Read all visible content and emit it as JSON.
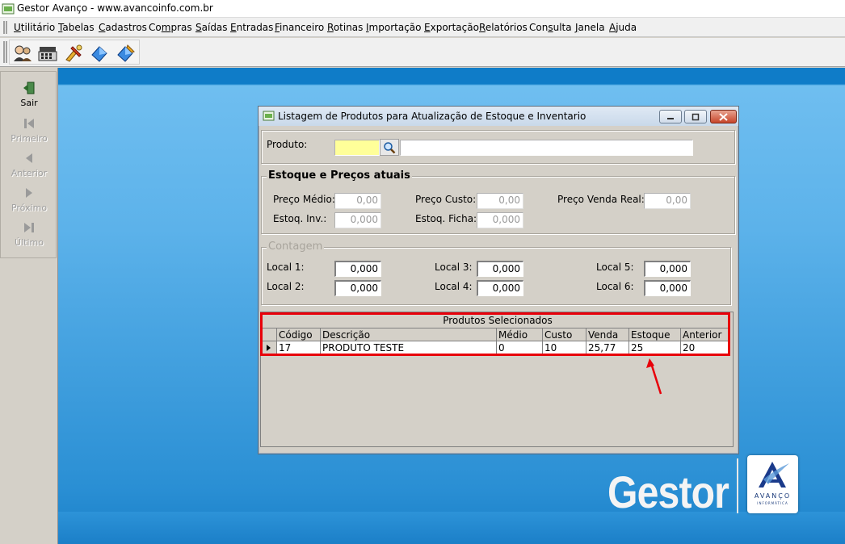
{
  "app": {
    "title": "Gestor Avanço - www.avancoinfo.com.br"
  },
  "menu": [
    {
      "label": "Utilitário",
      "accel": "U",
      "rest": "tilitário"
    },
    {
      "label": "Tabelas",
      "accel": "T",
      "rest": "abelas"
    },
    {
      "label": "Cadastros",
      "accel": "C",
      "rest": "adastros"
    },
    {
      "label": "Compras",
      "accel": "",
      "pre": "Co",
      "mid": "m",
      "rest": "pras"
    },
    {
      "label": "Saídas",
      "accel": "S",
      "rest": "aídas"
    },
    {
      "label": "Entradas",
      "accel": "E",
      "rest": "ntradas"
    },
    {
      "label": "Financeiro",
      "accel": "F",
      "rest": "inanceiro"
    },
    {
      "label": "Rotinas",
      "accel": "R",
      "rest": "otinas"
    },
    {
      "label": "Importação",
      "accel": "I",
      "rest": "mportação"
    },
    {
      "label": "Exportação",
      "accel": "E",
      "rest": "xportação"
    },
    {
      "label": "Relatórios",
      "accel": "R",
      "rest": "elatórios"
    },
    {
      "label": "Consulta",
      "accel": "",
      "pre": "Con",
      "mid": "s",
      "rest": "ulta"
    },
    {
      "label": "Janela",
      "accel": "J",
      "rest": "anela"
    },
    {
      "label": "Ajuda",
      "accel": "A",
      "rest": "juda"
    }
  ],
  "toolbar_icons": [
    "users-icon",
    "cash-register-icon",
    "tools-icon",
    "blue-box-icon",
    "blue-pen-box-icon"
  ],
  "sidebar": {
    "items": [
      {
        "label": "Sair",
        "icon": "exit-door-icon",
        "enabled": true
      },
      {
        "label": "Primeiro",
        "icon": "first-record-icon",
        "enabled": false
      },
      {
        "label": "Anterior",
        "icon": "previous-record-icon",
        "enabled": false
      },
      {
        "label": "Próximo",
        "icon": "next-record-icon",
        "enabled": false
      },
      {
        "label": "Último",
        "icon": "last-record-icon",
        "enabled": false
      }
    ]
  },
  "dialog": {
    "title": "Listagem de Produtos para Atualização de Estoque e Inventario",
    "produto": {
      "label": "Produto:",
      "code_value": "",
      "description_value": ""
    },
    "estoque_group": {
      "title": "Estoque e Preços atuais",
      "preco_medio": {
        "label": "Preço Médio:",
        "value": "0,00"
      },
      "preco_custo": {
        "label": "Preço Custo:",
        "value": "0,00"
      },
      "preco_venda_real": {
        "label": "Preço Venda Real:",
        "value": "0,00"
      },
      "estoq_inv": {
        "label": "Estoq. Inv.:",
        "value": "0,000"
      },
      "estoq_ficha": {
        "label": "Estoq. Ficha:",
        "value": "0,000"
      }
    },
    "contagem_group": {
      "title": "Contagem",
      "local1": {
        "label": "Local 1:",
        "value": "0,000"
      },
      "local2": {
        "label": "Local 2:",
        "value": "0,000"
      },
      "local3": {
        "label": "Local 3:",
        "value": "0,000"
      },
      "local4": {
        "label": "Local 4:",
        "value": "0,000"
      },
      "local5": {
        "label": "Local 5:",
        "value": "0,000"
      },
      "local6": {
        "label": "Local 6:",
        "value": "0,000"
      }
    },
    "grid": {
      "caption": "Produtos Selecionados",
      "columns": [
        "Código",
        "Descrição",
        "Médio",
        "Custo",
        "Venda",
        "Estoque",
        "Anterior"
      ],
      "rows": [
        [
          "17",
          "PRODUTO TESTE",
          "0",
          "10",
          "25,77",
          "25",
          "20"
        ]
      ]
    }
  },
  "branding": {
    "product": "Gestor",
    "logo_word": "AVANÇO",
    "logo_sub": "INFORMÁTICA"
  },
  "colors": {
    "desktop_blue": "#5cb2ea",
    "highlight_red": "#e8000a",
    "yellow_field": "#ffff99"
  }
}
